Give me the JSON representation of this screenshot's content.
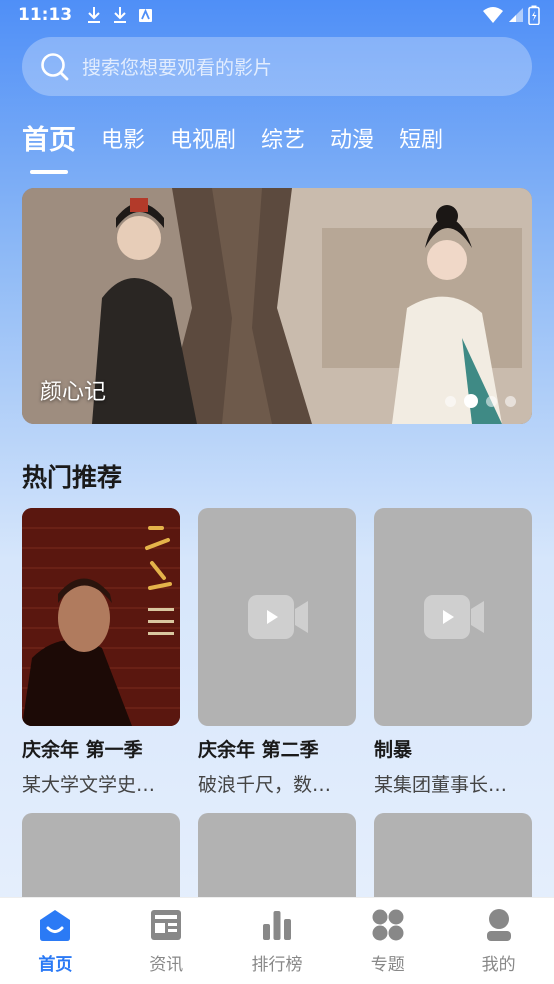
{
  "status_bar": {
    "time": "11:13"
  },
  "search": {
    "placeholder": "搜索您想要观看的影片"
  },
  "tabs": [
    {
      "label": "首页",
      "active": true
    },
    {
      "label": "电影"
    },
    {
      "label": "电视剧"
    },
    {
      "label": "综艺"
    },
    {
      "label": "动漫"
    },
    {
      "label": "短剧"
    }
  ],
  "banner": {
    "title": "颜心记",
    "slide_count": 4,
    "active_index": 1
  },
  "section": {
    "title": "热门推荐"
  },
  "cards": [
    {
      "title": "庆余年 第一季",
      "desc": "某大学文学史…",
      "poster": "qing-yu-nian"
    },
    {
      "title": "庆余年 第二季",
      "desc": "破浪千尺，数…",
      "poster": "placeholder"
    },
    {
      "title": "制暴",
      "desc": "某集团董事长…",
      "poster": "placeholder"
    }
  ],
  "nav": [
    {
      "label": "首页",
      "icon": "home-icon",
      "active": true
    },
    {
      "label": "资讯",
      "icon": "news-icon"
    },
    {
      "label": "排行榜",
      "icon": "ranking-icon"
    },
    {
      "label": "专题",
      "icon": "topics-icon"
    },
    {
      "label": "我的",
      "icon": "profile-icon"
    }
  ],
  "colors": {
    "accent": "#2b7af5",
    "placeholder": "#b2b2b2"
  }
}
